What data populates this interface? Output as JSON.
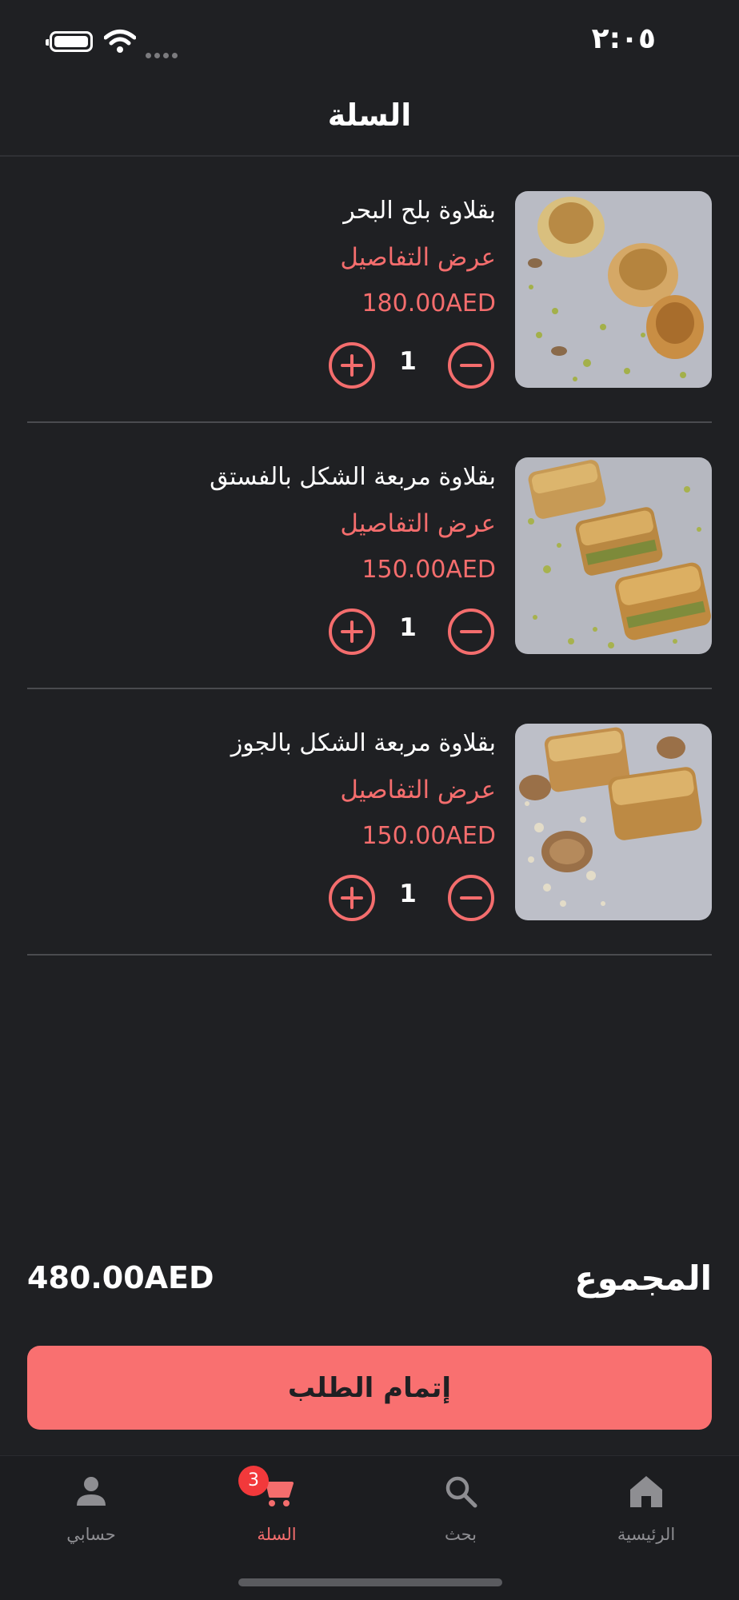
{
  "status_bar": {
    "time": "٢:٠٥"
  },
  "header": {
    "title": "السلة"
  },
  "cart": {
    "details_label": "عرض التفاصيل",
    "items": [
      {
        "name": "بقلاوة بلح البحر",
        "price": "180.00AED",
        "quantity": "1"
      },
      {
        "name": "بقلاوة مربعة الشكل بالفستق",
        "price": "150.00AED",
        "quantity": "1"
      },
      {
        "name": "بقلاوة مربعة الشكل بالجوز",
        "price": "150.00AED",
        "quantity": "1"
      }
    ]
  },
  "total": {
    "label": "المجموع",
    "amount": "480.00AED"
  },
  "checkout": {
    "label": "إتمام الطلب"
  },
  "tabs": {
    "account": {
      "label": "حسابي",
      "icon": "person-icon"
    },
    "cart": {
      "label": "السلة",
      "icon": "cart-icon",
      "badge": "3"
    },
    "search": {
      "label": "بحث",
      "icon": "search-icon"
    },
    "home": {
      "label": "الرئيسية",
      "icon": "home-icon"
    }
  },
  "colors": {
    "background": "#1f2023",
    "accent": "#f46d6d",
    "button": "#f97070",
    "badge": "#f2393b",
    "inactive": "#8e8e92"
  }
}
